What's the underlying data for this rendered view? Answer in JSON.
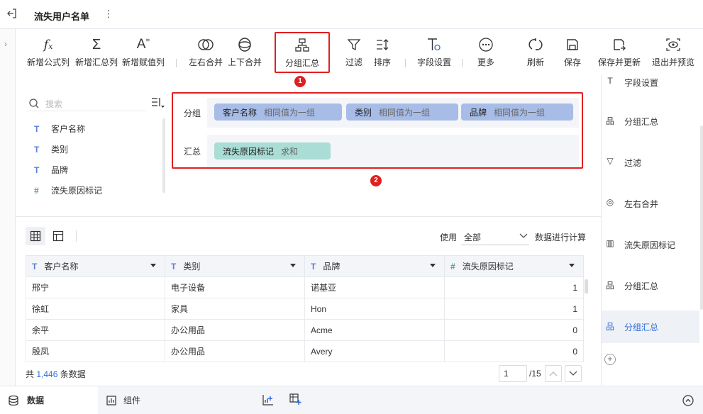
{
  "header": {
    "title": "流失用户名单"
  },
  "toolbar": {
    "items": [
      {
        "label": "新增公式列",
        "icon": "formula-icon"
      },
      {
        "label": "新增汇总列",
        "icon": "sigma-icon"
      },
      {
        "label": "新增赋值列",
        "icon": "assign-icon"
      },
      {
        "label": "左右合并",
        "icon": "merge-lr-icon"
      },
      {
        "label": "上下合并",
        "icon": "merge-ud-icon"
      },
      {
        "label": "分组汇总",
        "icon": "group-icon"
      },
      {
        "label": "过滤",
        "icon": "filter-icon"
      },
      {
        "label": "排序",
        "icon": "sort-icon"
      },
      {
        "label": "字段设置",
        "icon": "field-settings-icon"
      },
      {
        "label": "更多",
        "icon": "more-icon"
      },
      {
        "label": "刷新",
        "icon": "refresh-icon"
      },
      {
        "label": "保存",
        "icon": "save-icon"
      },
      {
        "label": "保存并更新",
        "icon": "save-update-icon"
      },
      {
        "label": "退出并预览",
        "icon": "preview-icon"
      }
    ]
  },
  "annotations": {
    "badge1": "1",
    "badge2": "2"
  },
  "fields": {
    "search_placeholder": "搜索",
    "items": [
      {
        "type": "T",
        "name": "客户名称"
      },
      {
        "type": "T",
        "name": "类别"
      },
      {
        "type": "T",
        "name": "品牌"
      },
      {
        "type": "#",
        "name": "流失原因标记"
      }
    ]
  },
  "group": {
    "group_label": "分组",
    "summary_label": "汇总",
    "group_chips": [
      {
        "name": "客户名称",
        "mode": "相同值为一组"
      },
      {
        "name": "类别",
        "mode": "相同值为一组"
      },
      {
        "name": "品牌",
        "mode": "相同值为一组"
      }
    ],
    "summary_chips": [
      {
        "name": "流失原因标记",
        "mode": "求和"
      }
    ]
  },
  "table_controls": {
    "use_label": "使用",
    "select_value": "全部",
    "suffix": "数据进行计算"
  },
  "table": {
    "columns": [
      {
        "type": "T",
        "name": "客户名称"
      },
      {
        "type": "T",
        "name": "类别"
      },
      {
        "type": "T",
        "name": "品牌"
      },
      {
        "type": "#",
        "name": "流失原因标记"
      }
    ],
    "rows": [
      [
        "邢宁",
        "电子设备",
        "诺基亚",
        "1"
      ],
      [
        "徐虹",
        "家具",
        "Hon",
        "1"
      ],
      [
        "余平",
        "办公用品",
        "Acme",
        "0"
      ],
      [
        "殷凤",
        "办公用品",
        "Avery",
        "0"
      ]
    ]
  },
  "footer": {
    "prefix": "共",
    "count": "1,446",
    "suffix": "条数据",
    "page": "1",
    "total_pages": "/15"
  },
  "steps": [
    {
      "label": "字段设置",
      "icon": "field-settings-icon",
      "active": false
    },
    {
      "label": "分组汇总",
      "icon": "group-icon",
      "active": false
    },
    {
      "label": "过滤",
      "icon": "filter-icon",
      "active": false
    },
    {
      "label": "左右合并",
      "icon": "merge-lr-icon",
      "active": false
    },
    {
      "label": "流失原因标记",
      "icon": "column-icon",
      "active": false
    },
    {
      "label": "分组汇总",
      "icon": "group-icon",
      "active": false
    },
    {
      "label": "分组汇总",
      "icon": "group-icon",
      "active": true
    }
  ],
  "bottom_tabs": [
    {
      "label": "数据",
      "icon": "database-icon",
      "active": true
    },
    {
      "label": "组件",
      "icon": "chart-icon",
      "active": false
    }
  ],
  "colors": {
    "accent": "#2f6bd8",
    "highlight": "#e02020",
    "chip_blue": "#a7bce6",
    "chip_teal": "#a9ddd5"
  }
}
